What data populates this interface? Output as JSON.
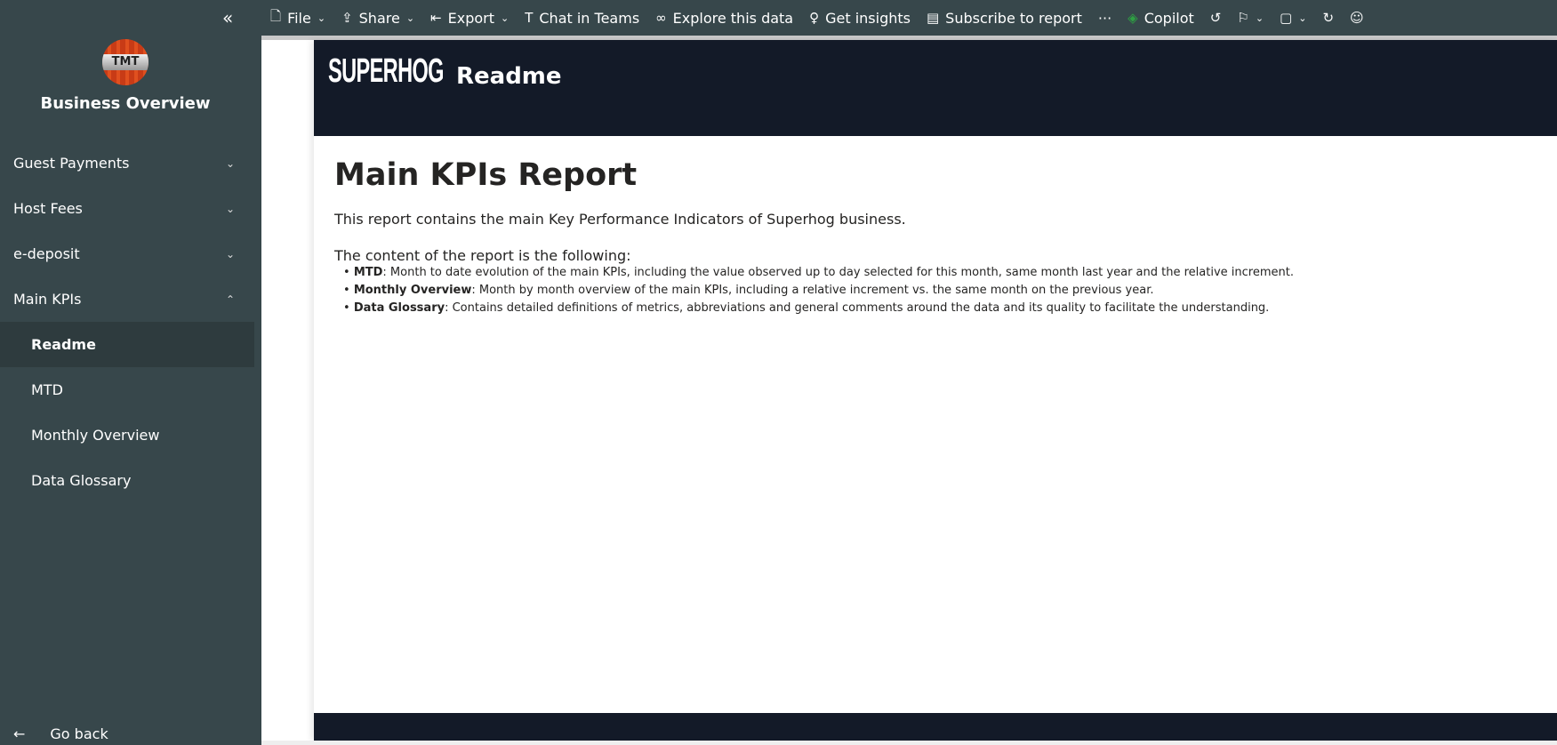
{
  "sidebar": {
    "app_name": "Business Overview",
    "logo_text": "TMT",
    "collapse_icon": "«",
    "items": [
      {
        "label": "Guest Payments",
        "chevron": "⌄"
      },
      {
        "label": "Host Fees",
        "chevron": "⌄"
      },
      {
        "label": "e-deposit",
        "chevron": "⌄"
      },
      {
        "label": "Main KPIs",
        "chevron": "⌃"
      },
      {
        "label": "Readme"
      },
      {
        "label": "MTD"
      },
      {
        "label": "Monthly Overview"
      },
      {
        "label": "Data Glossary"
      }
    ],
    "go_back": "Go back",
    "go_back_icon": "←"
  },
  "toolbar": {
    "file": "File",
    "share": "Share",
    "export": "Export",
    "chat": "Chat in Teams",
    "explore": "Explore this data",
    "insights": "Get insights",
    "subscribe": "Subscribe to report",
    "more": "···",
    "copilot": "Copilot"
  },
  "report": {
    "brand": "SUPERHOG",
    "title": "Readme",
    "heading": "Main KPIs Report",
    "intro": "This report contains the main Key Performance Indicators of Superhog business.",
    "content_intro": "The content of the report is the following:",
    "bullets": [
      {
        "term": "MTD",
        "text": ": Month to date evolution of the main KPIs, including the value observed up to day selected for this month, same month last year and the relative increment."
      },
      {
        "term": "Monthly Overview",
        "text": ": Month by month overview of the main KPIs, including a relative increment vs. the same month on the previous year."
      },
      {
        "term": "Data Glossary",
        "text": ": Contains detailed definitions of metrics, abbreviations and general comments around the data and its quality to facilitate the understanding."
      }
    ]
  }
}
